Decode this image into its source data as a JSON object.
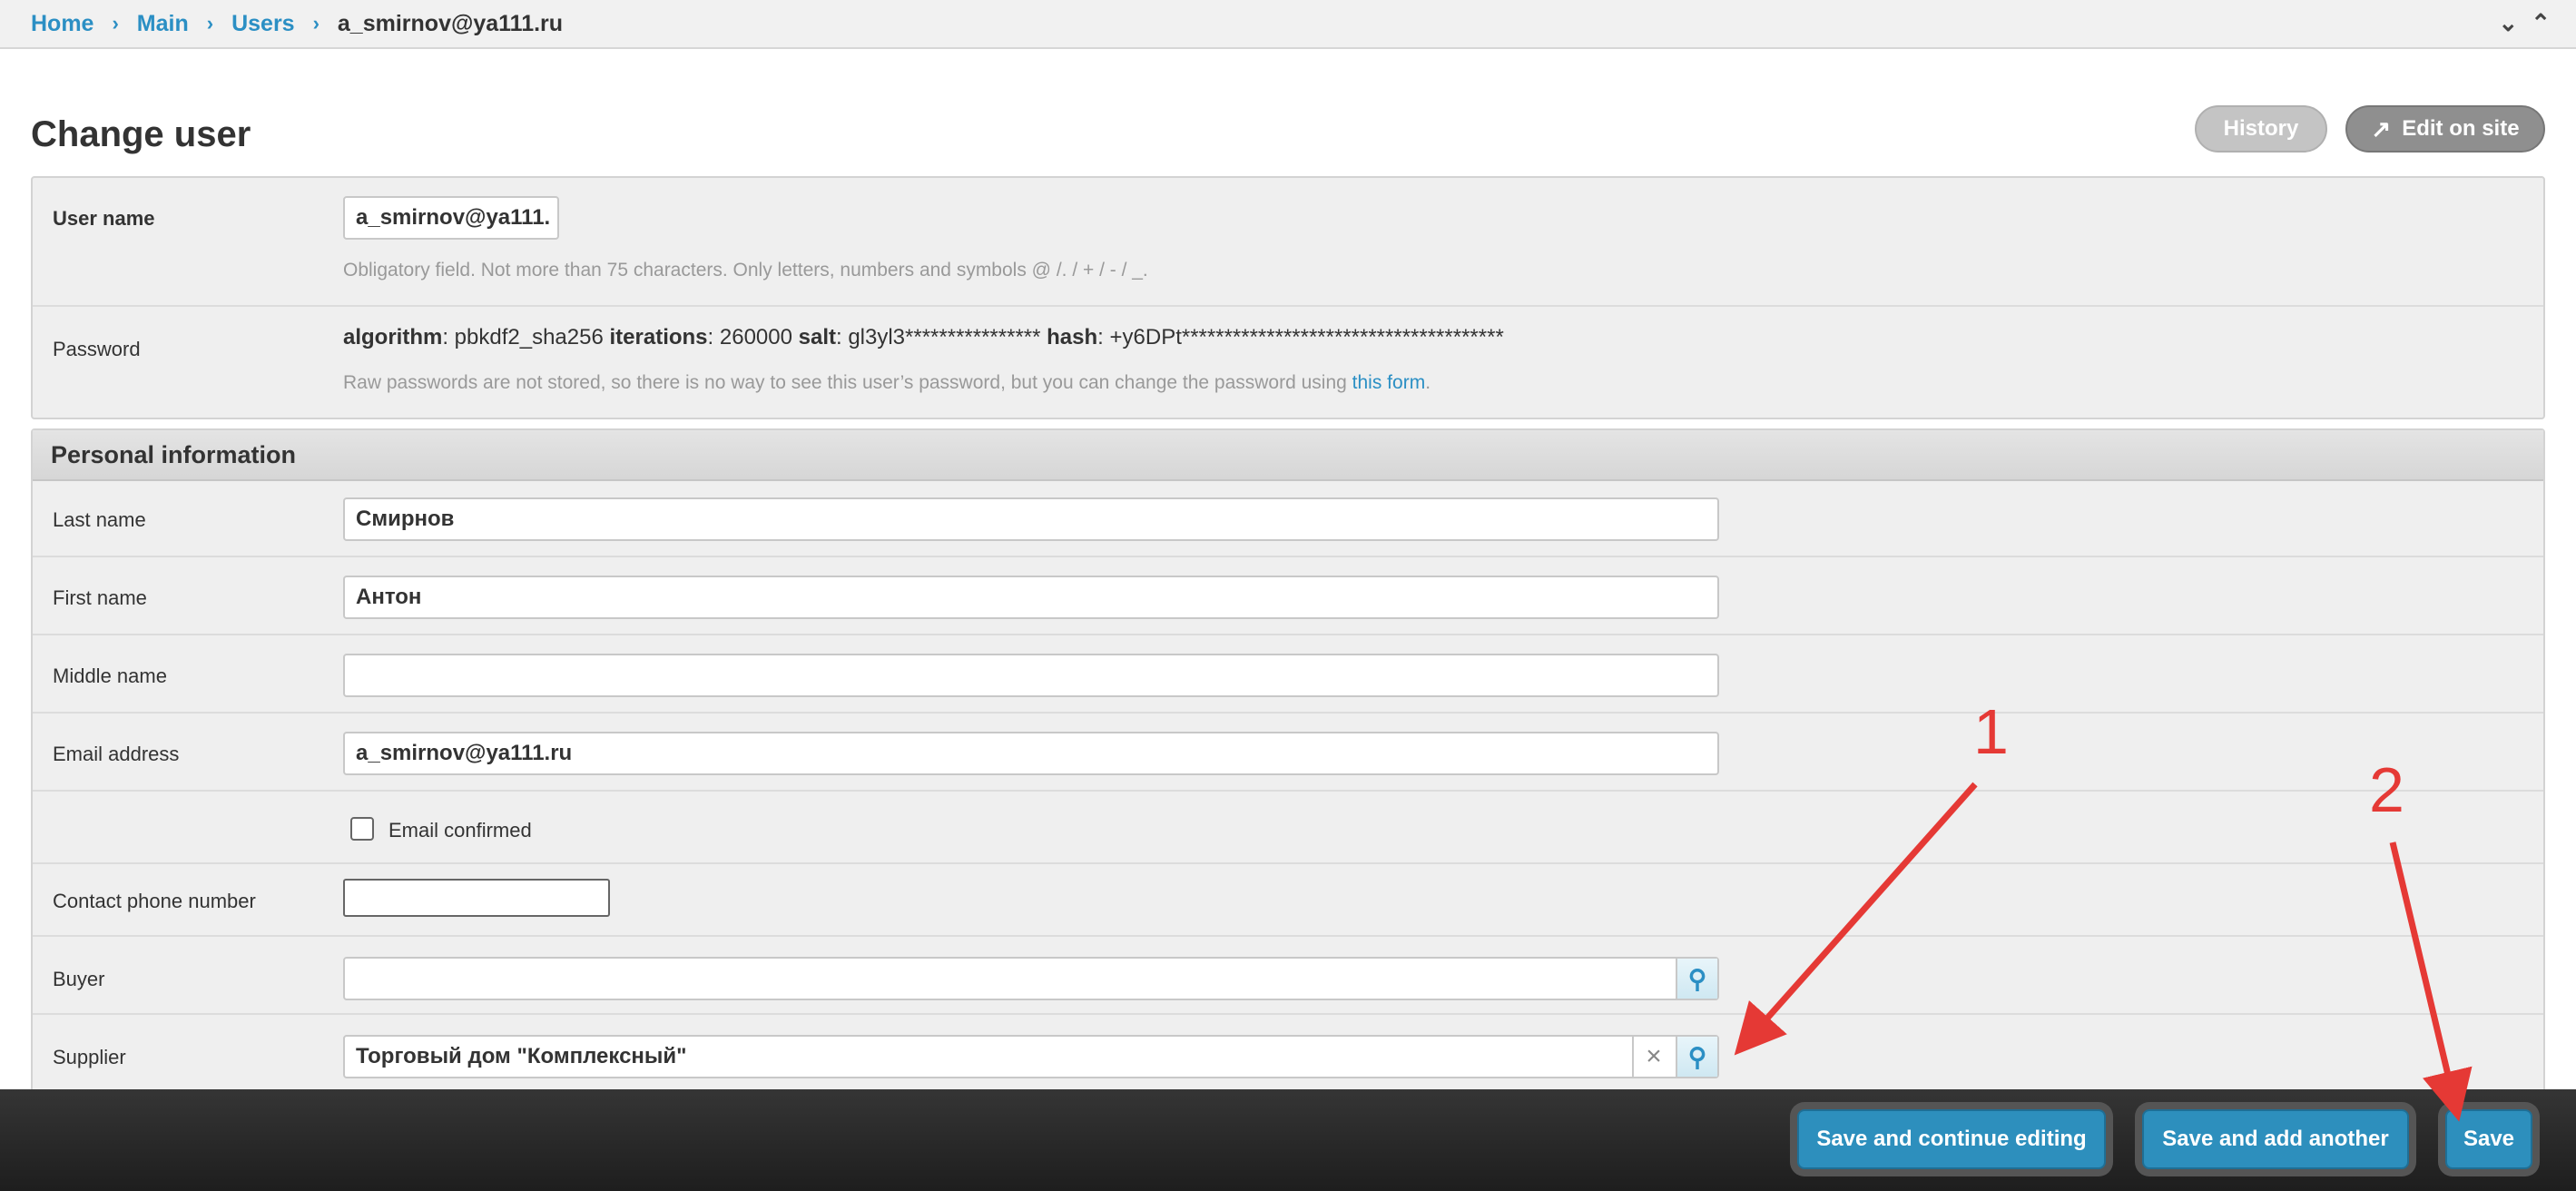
{
  "breadcrumb": {
    "items": [
      "Home",
      "Main",
      "Users"
    ],
    "current": "a_smirnov@ya111.ru",
    "separator": ">"
  },
  "header": {
    "title": "Change user",
    "history_label": "History",
    "edit_on_site_label": "Edit on site"
  },
  "account": {
    "username_label": "User name",
    "username_value": "a_smirnov@ya111.",
    "username_help": "Obligatory field. Not more than 75 characters. Only letters, numbers and symbols @ /. / + / - / _.",
    "password_label": "Password",
    "password": {
      "algorithm_key": "algorithm",
      "algorithm_value": ": pbkdf2_sha256 ",
      "iterations_key": "iterations",
      "iterations_value": ": 260000 ",
      "salt_key": "salt",
      "salt_value": ": gl3yl3**************** ",
      "hash_key": "hash",
      "hash_value": ": +y6DPt**************************************"
    },
    "password_help_prefix": "Raw passwords are not stored, so there is no way to see this user’s password, but you can change the password using ",
    "password_help_link": "this form",
    "password_help_suffix": "."
  },
  "personal": {
    "section_title": "Personal information",
    "last_name_label": "Last name",
    "last_name_value": "Смирнов",
    "first_name_label": "First name",
    "first_name_value": "Антон",
    "middle_name_label": "Middle name",
    "middle_name_value": "",
    "email_label": "Email address",
    "email_value": "a_smirnov@ya111.ru",
    "email_confirmed_label": "Email confirmed",
    "email_confirmed": false,
    "phone_label": "Contact phone number",
    "phone_value": "",
    "buyer_label": "Buyer",
    "buyer_value": "",
    "supplier_label": "Supplier",
    "supplier_value": "Торговый дом \"Комплексный\""
  },
  "submit": {
    "continue_label": "Save and continue editing",
    "another_label": "Save and add another",
    "save_label": "Save"
  },
  "annotations": {
    "marker_1": "1",
    "marker_2": "2",
    "color": "#e53935"
  },
  "icons": {
    "collapse_down": "double-chevron-down-icon",
    "collapse_up": "double-chevron-up-icon",
    "lookup": "magnifier-icon",
    "clear": "close-icon",
    "external": "arrow-up-right-icon"
  }
}
